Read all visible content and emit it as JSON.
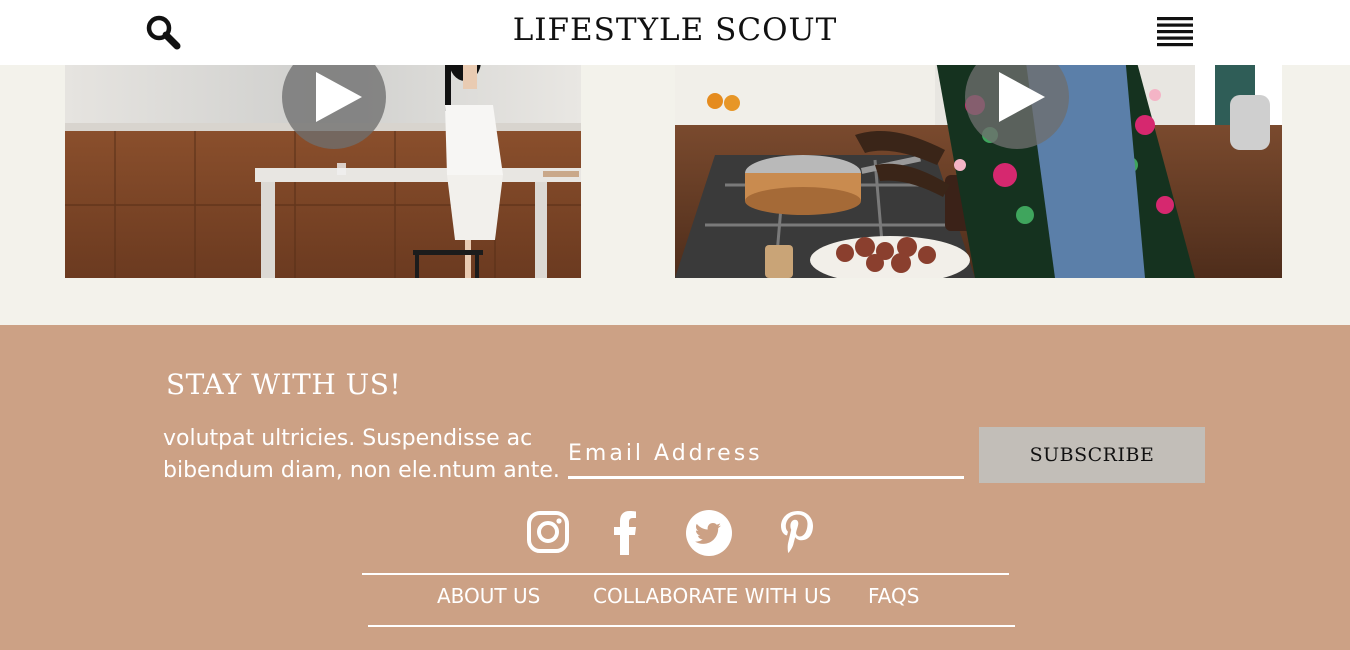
{
  "header": {
    "site_title": "LIFESTYLE SCOUT",
    "search_icon": "search-icon",
    "menu_icon": "hamburger-menu-icon"
  },
  "videos": [
    {
      "description": "woman seated at wooden kitchen table",
      "play_icon": "play-icon"
    },
    {
      "description": "person cooking at stovetop in floral shirt and apron",
      "play_icon": "play-icon"
    }
  ],
  "footer": {
    "heading": "STAY WITH US!",
    "text": "volutpat ultricies. Suspendisse ac bibendum diam, non ele.ntum ante.",
    "email_placeholder": "Email Address",
    "subscribe_label": "SUBSCRIBE",
    "social_icons": [
      "instagram-icon",
      "facebook-icon",
      "twitter-icon",
      "pinterest-icon"
    ],
    "links": [
      "ABOUT US",
      "COLLABORATE WITH US",
      "FAQS"
    ]
  },
  "colors": {
    "header_bg": "#ffffff",
    "section_bg": "#f3f2eb",
    "footer_bg": "#cca185",
    "button_bg": "#c2beb8",
    "text_light": "#ffffff"
  }
}
